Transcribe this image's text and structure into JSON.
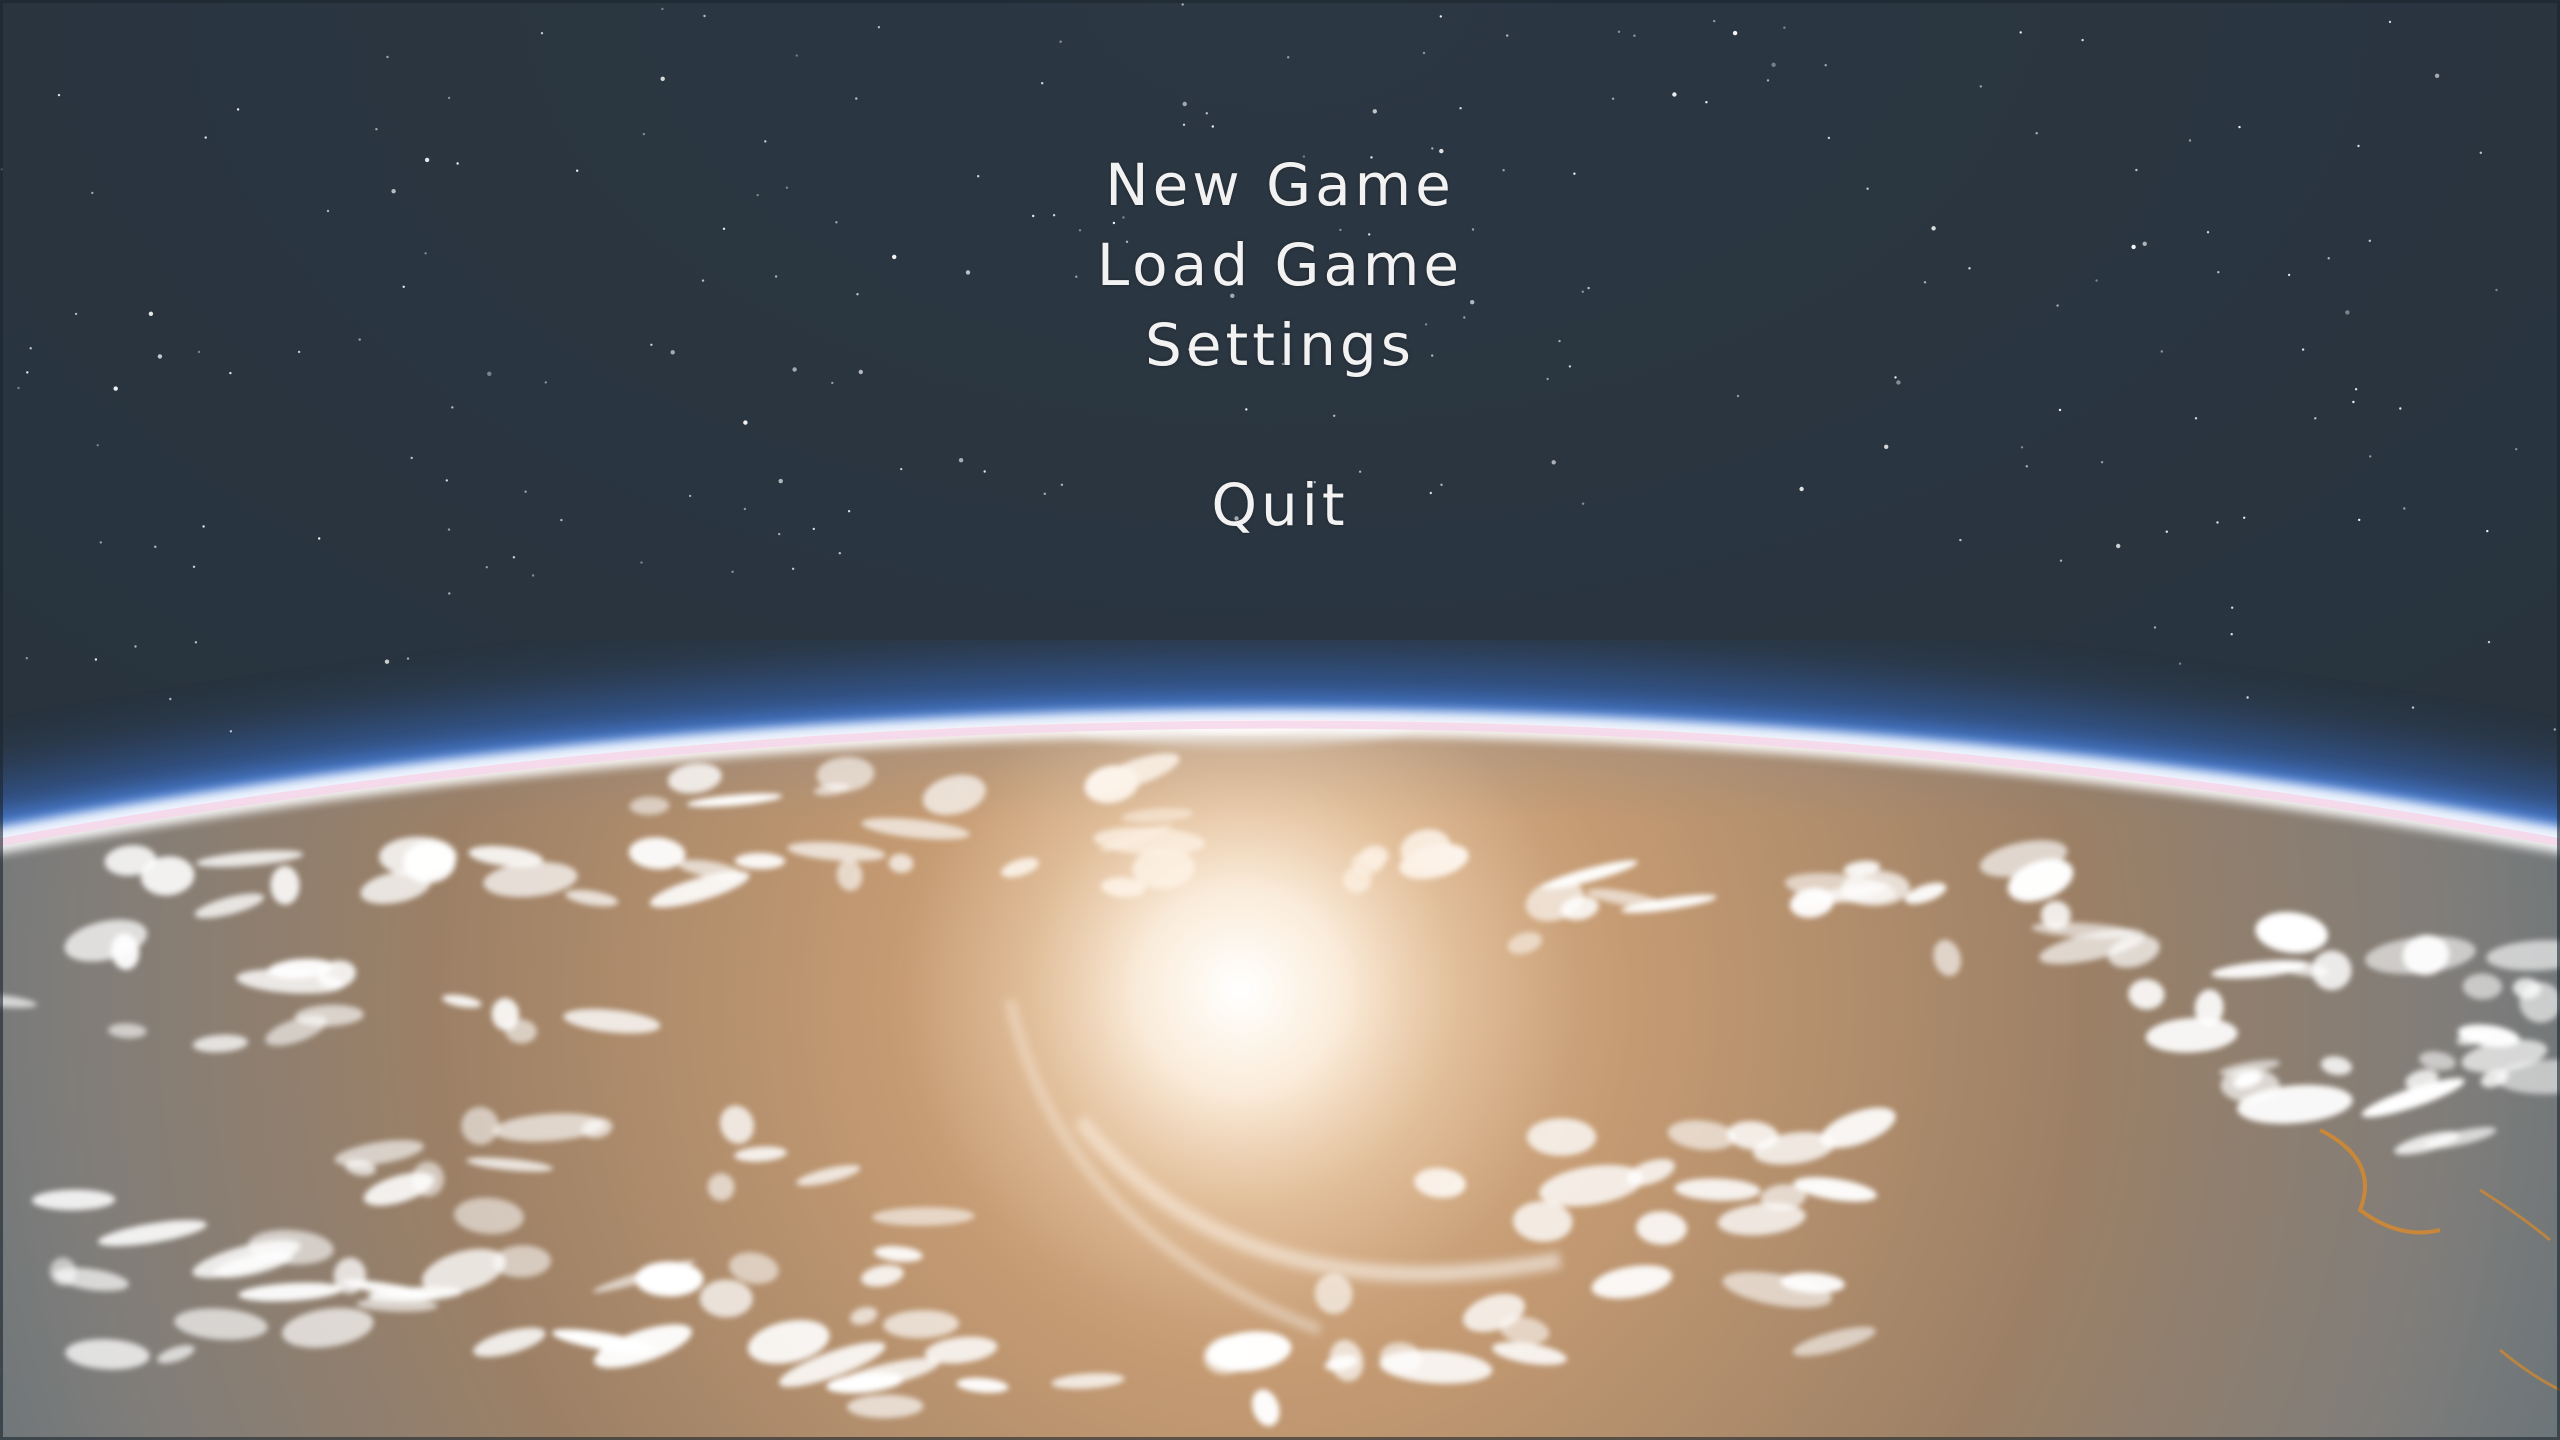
{
  "menu": {
    "new_game": "New Game",
    "load_game": "Load Game",
    "settings": "Settings",
    "quit": "Quit"
  },
  "background": {
    "description_icon": "planet-earth-from-orbit",
    "space_color": "#2c3844",
    "atmosphere_color": "#4a88f0",
    "horizon_glow_color": "#ffffff",
    "surface_color": "#a8845e",
    "sun_glint_color": "#fff5e8"
  }
}
